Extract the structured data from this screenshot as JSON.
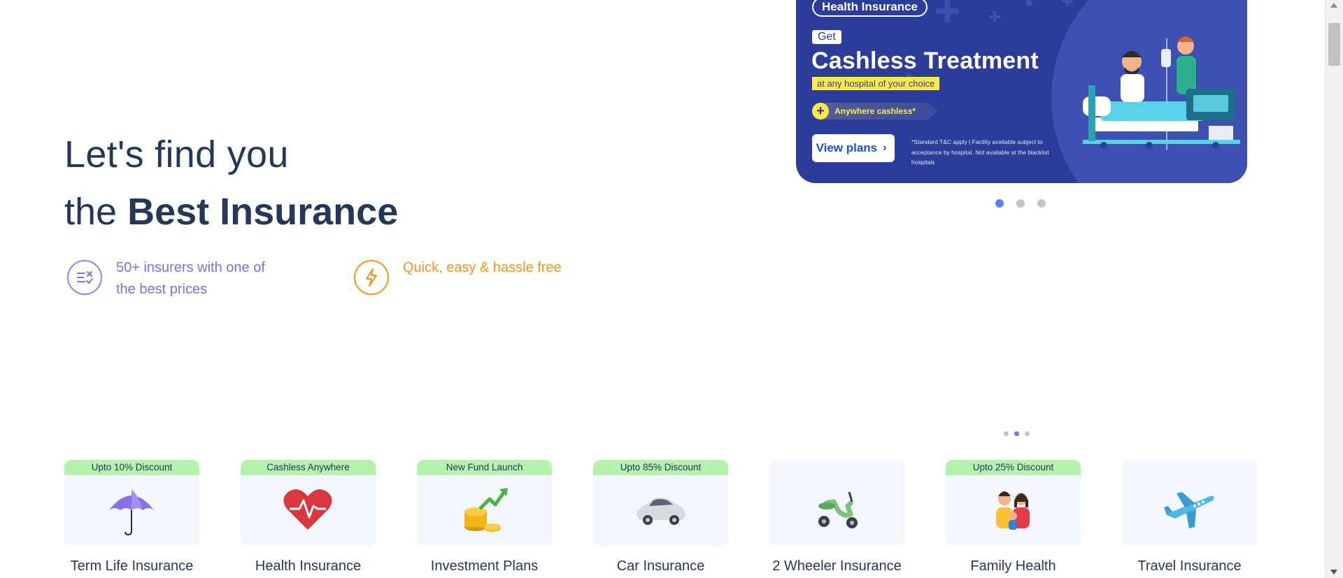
{
  "hero": {
    "line1": "Let's find you",
    "line2_prefix": "the ",
    "line2_bold": "Best Insurance"
  },
  "features": [
    {
      "icon": "compare-icon",
      "text": "50+ insurers with one of the best prices",
      "color": "#7e6fe8"
    },
    {
      "icon": "lightning-icon",
      "text": "Quick, easy & hassle free",
      "color": "#f2921e"
    }
  ],
  "banner": {
    "tag": "Health Insurance",
    "get": "Get",
    "headline": "Cashless Treatment",
    "subline": "at any hospital of your choice",
    "pill": "Anywhere cashless*",
    "cta": "View plans",
    "disclaimer": "*Standard T&C apply | Facility available subject to acceptance by hospital. Not available at the blacklist hospitals",
    "bg_color": "#2b3d98",
    "accent_color": "#ffe84d"
  },
  "carousel": {
    "slides": 3,
    "active": 1
  },
  "products_carousel": {
    "pages": 3,
    "active": 2
  },
  "products": [
    {
      "label": "Term Life Insurance",
      "badge": "Upto 10% Discount",
      "icon": "umbrella-icon"
    },
    {
      "label": "Health Insurance",
      "badge": "Cashless Anywhere",
      "icon": "heart-pulse-icon"
    },
    {
      "label": "Investment Plans",
      "badge": "New Fund Launch",
      "icon": "coins-growth-icon"
    },
    {
      "label": "Car Insurance",
      "badge": "Upto 85% Discount",
      "icon": "car-icon"
    },
    {
      "label": "2 Wheeler Insurance",
      "badge": "",
      "icon": "scooter-icon"
    },
    {
      "label": "Family Health",
      "badge": "Upto 25% Discount",
      "icon": "family-icon"
    },
    {
      "label": "Travel Insurance",
      "badge": "",
      "icon": "airplane-icon"
    }
  ]
}
